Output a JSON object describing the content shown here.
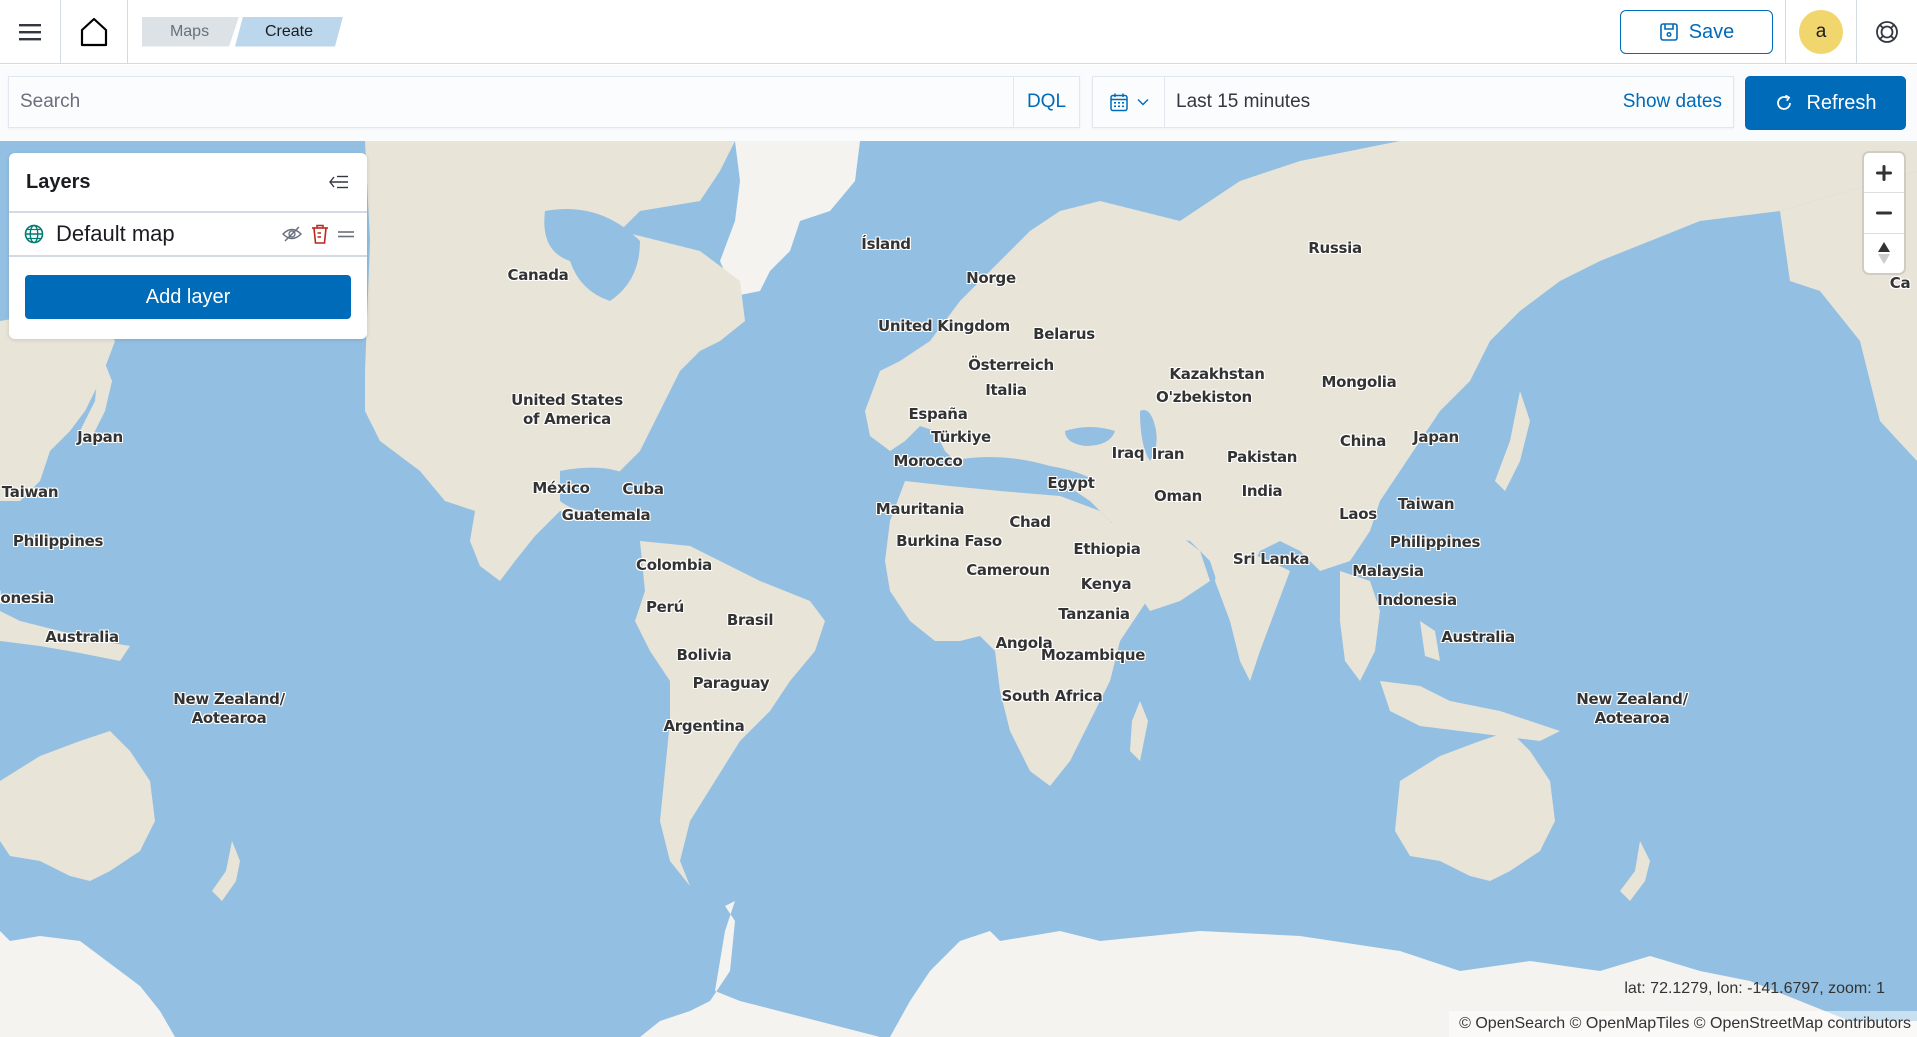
{
  "header": {
    "menu_icon": "hamburger-menu-icon",
    "home_icon": "home-icon",
    "breadcrumbs": [
      {
        "label": "Maps"
      },
      {
        "label": "Create"
      }
    ],
    "save_label": "Save",
    "save_icon": "save-disk-icon",
    "avatar_initial": "a",
    "help_icon": "help-lifebuoy-icon"
  },
  "query": {
    "search_placeholder": "Search",
    "search_value": "",
    "language_label": "DQL",
    "date_quick_icon": "calendar-icon",
    "date_range_label": "Last 15 minutes",
    "show_dates_label": "Show dates",
    "refresh_label": "Refresh",
    "refresh_icon": "refresh-icon"
  },
  "layers_panel": {
    "title": "Layers",
    "collapse_icon": "collapse-panel-icon",
    "layers": [
      {
        "name": "Default map",
        "type_icon": "globe-icon",
        "visibility_icon": "eye-closed-icon",
        "delete_icon": "trash-icon",
        "drag_icon": "drag-handle-icon"
      }
    ],
    "add_layer_label": "Add layer"
  },
  "map": {
    "colors": {
      "water": "#93c0e2",
      "land": "#e8e4d8",
      "ice": "#f4f3ef",
      "accent": "#006bb8",
      "danger": "#bd271e"
    },
    "labels": [
      {
        "text": "Canada"
      },
      {
        "text": "United States\nof America"
      },
      {
        "text": "México"
      },
      {
        "text": "Cuba"
      },
      {
        "text": "Guatemala"
      },
      {
        "text": "Colombia"
      },
      {
        "text": "Perú"
      },
      {
        "text": "Brasil"
      },
      {
        "text": "Bolivia"
      },
      {
        "text": "Paraguay"
      },
      {
        "text": "Argentina"
      },
      {
        "text": "Ísland"
      },
      {
        "text": "Norge"
      },
      {
        "text": "United Kingdom"
      },
      {
        "text": "Belarus"
      },
      {
        "text": "Österreich"
      },
      {
        "text": "Italia"
      },
      {
        "text": "España"
      },
      {
        "text": "Türkiye"
      },
      {
        "text": "Morocco"
      },
      {
        "text": "Egypt"
      },
      {
        "text": "Iraq"
      },
      {
        "text": "Iran"
      },
      {
        "text": "Mauritania"
      },
      {
        "text": "Chad"
      },
      {
        "text": "Burkina Faso"
      },
      {
        "text": "Ethiopia"
      },
      {
        "text": "Cameroun"
      },
      {
        "text": "Kenya"
      },
      {
        "text": "Tanzania"
      },
      {
        "text": "Angola"
      },
      {
        "text": "Mozambique"
      },
      {
        "text": "South Africa"
      },
      {
        "text": "Russia"
      },
      {
        "text": "Kazakhstan"
      },
      {
        "text": "O'zbekiston"
      },
      {
        "text": "Mongolia"
      },
      {
        "text": "China"
      },
      {
        "text": "Pakistan"
      },
      {
        "text": "Oman"
      },
      {
        "text": "India"
      },
      {
        "text": "Sri Lanka"
      },
      {
        "text": "Laos"
      },
      {
        "text": "Malaysia"
      },
      {
        "text": "Indonesia"
      },
      {
        "text": "Taiwan"
      },
      {
        "text": "Philippines"
      },
      {
        "text": "Japan"
      },
      {
        "text": "Australia"
      },
      {
        "text": "New Zealand/\nAotearoa"
      },
      {
        "text": "Japan"
      },
      {
        "text": "Taiwan"
      },
      {
        "text": "Philippines"
      },
      {
        "text": "donesia"
      },
      {
        "text": "Australia"
      },
      {
        "text": "New Zealand/\nAotearoa"
      },
      {
        "text": "Ca"
      }
    ],
    "zoom_in_icon": "zoom-in-plus-icon",
    "zoom_out_icon": "zoom-out-minus-icon",
    "compass_icon": "compass-north-icon",
    "coordinates": {
      "lat": 72.1279,
      "lon": -141.6797,
      "zoom": 1
    },
    "coordinates_text": "lat: 72.1279, lon: -141.6797, zoom: 1",
    "attribution": "© OpenSearch © OpenMapTiles © OpenStreetMap contributors"
  }
}
